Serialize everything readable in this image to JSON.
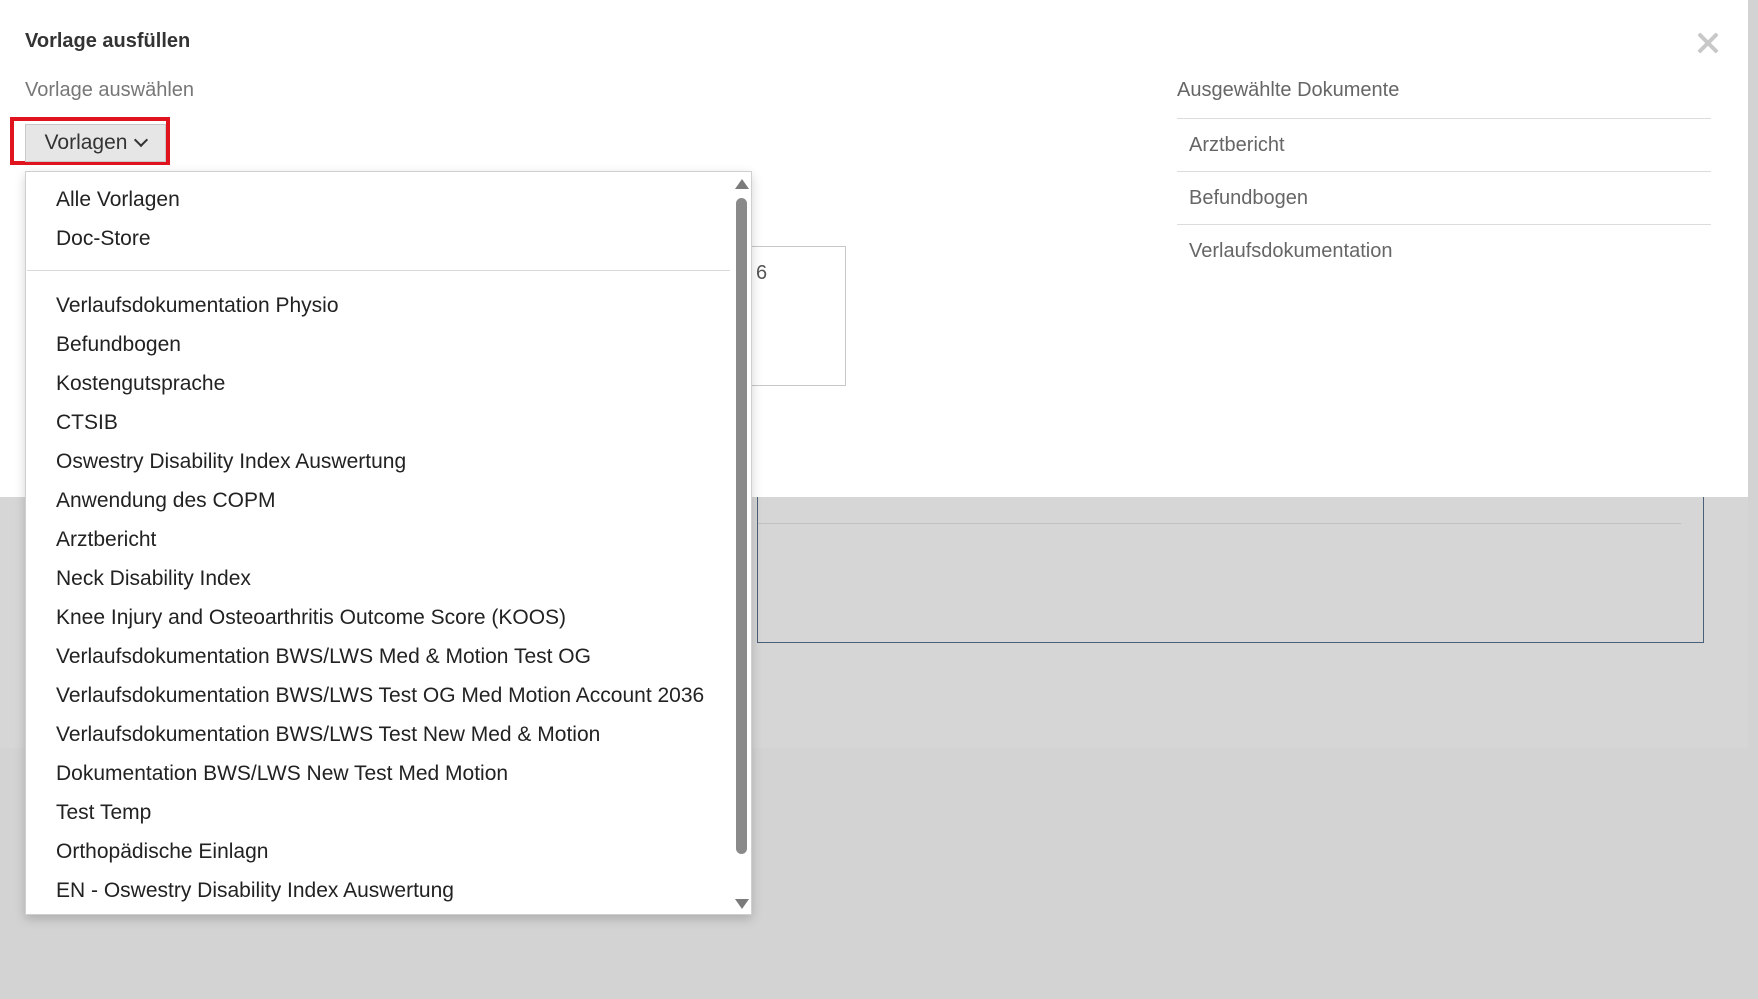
{
  "modal": {
    "title": "Vorlage ausfüllen",
    "select_label": "Vorlage auswählen",
    "vorlagen_button": "Vorlagen",
    "hidden_value": "6"
  },
  "selected_documents": {
    "title": "Ausgewählte Dokumente",
    "items": [
      "Arztbericht",
      "Befundbogen",
      "Verlaufsdokumentation"
    ]
  },
  "dropdown": {
    "top_items": [
      "Alle Vorlagen",
      "Doc-Store"
    ],
    "items": [
      "Verlaufsdokumentation Physio",
      "Befundbogen",
      "Kostengutsprache",
      "CTSIB",
      "Oswestry Disability Index Auswertung",
      "Anwendung des COPM",
      "Arztbericht",
      "Neck Disability Index",
      "Knee Injury and Osteoarthritis Outcome Score (KOOS)",
      "Verlaufsdokumentation BWS/LWS Med & Motion Test OG",
      "Verlaufsdokumentation BWS/LWS Test OG Med Motion Account 2036",
      "Verlaufsdokumentation BWS/LWS Test New Med & Motion",
      "Dokumentation BWS/LWS New Test Med Motion",
      "Test Temp",
      "Orthopädische Einlagn",
      "EN - Oswestry Disability Index Auswertung"
    ]
  },
  "colors": {
    "highlight": "#e0141e",
    "backdrop": "#d3d3d3",
    "accent_green": "#5cb85c"
  }
}
